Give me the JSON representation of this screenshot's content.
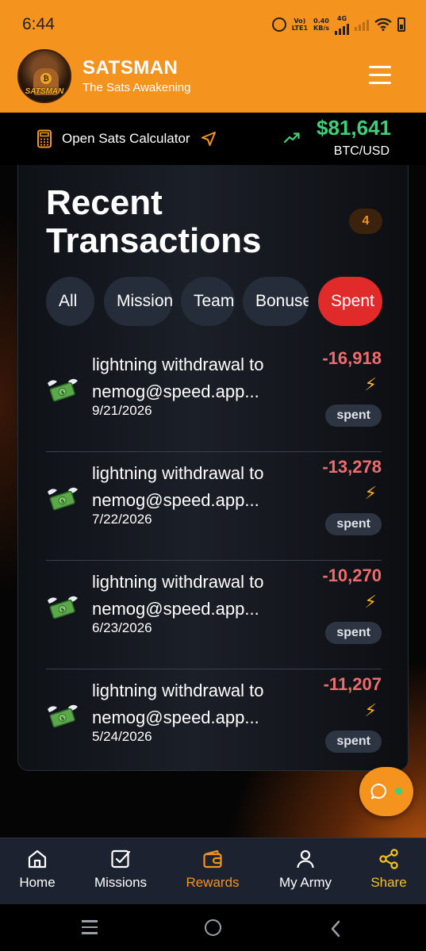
{
  "status_bar": {
    "time": "6:44",
    "network_label_top": "Vo)",
    "network_label_bottom": "LTE1",
    "speed_value": "0.40",
    "speed_unit": "KB/s",
    "network_type": "4G"
  },
  "header": {
    "logo_text": "SATSMAN",
    "title": "SATSMAN",
    "subtitle": "The Sats Awakening",
    "menu_icon": "hamburger-icon"
  },
  "price_bar": {
    "calculator_label": "Open Sats Calculator",
    "price": "$81,641",
    "pair": "BTC/USD",
    "trend": "up"
  },
  "transactions": {
    "title": "Recent Transactions",
    "count": "4",
    "filters": [
      {
        "label": "All",
        "active": false
      },
      {
        "label": "Missions",
        "active": false
      },
      {
        "label": "Team",
        "active": false
      },
      {
        "label": "Bonuses",
        "active": false
      },
      {
        "label": "Spent",
        "active": true
      }
    ],
    "items": [
      {
        "line1": "lightning withdrawal to",
        "line2": "nemog@speed.app...",
        "date": "9/21/2026",
        "amount": "-16,918",
        "bolt": "⚡",
        "status": "spent",
        "icon": "money-with-wings-icon"
      },
      {
        "line1": "lightning withdrawal to",
        "line2": "nemog@speed.app...",
        "date": "7/22/2026",
        "amount": "-13,278",
        "bolt": "⚡",
        "status": "spent",
        "icon": "money-with-wings-icon"
      },
      {
        "line1": "lightning withdrawal to",
        "line2": "nemog@speed.app...",
        "date": "6/23/2026",
        "amount": "-10,270",
        "bolt": "⚡",
        "status": "spent",
        "icon": "money-with-wings-icon"
      },
      {
        "line1": "lightning withdrawal to",
        "line2": "nemog@speed.app...",
        "date": "5/24/2026",
        "amount": "-11,207",
        "bolt": "⚡",
        "status": "spent",
        "icon": "money-with-wings-icon"
      }
    ]
  },
  "bottom_nav": [
    {
      "label": "Home",
      "icon": "home-icon",
      "active": false
    },
    {
      "label": "Missions",
      "icon": "checkbox-icon",
      "active": false
    },
    {
      "label": "Rewards",
      "icon": "wallet-icon",
      "active": true
    },
    {
      "label": "My Army",
      "icon": "user-icon",
      "active": false
    },
    {
      "label": "Share",
      "icon": "share-icon",
      "active": false
    }
  ],
  "colors": {
    "brand_orange": "#f5931f",
    "price_green": "#3fd07a",
    "negative_red": "#f06c6c",
    "active_filter_red": "#e12a2a",
    "nav_background": "#1c2230"
  }
}
